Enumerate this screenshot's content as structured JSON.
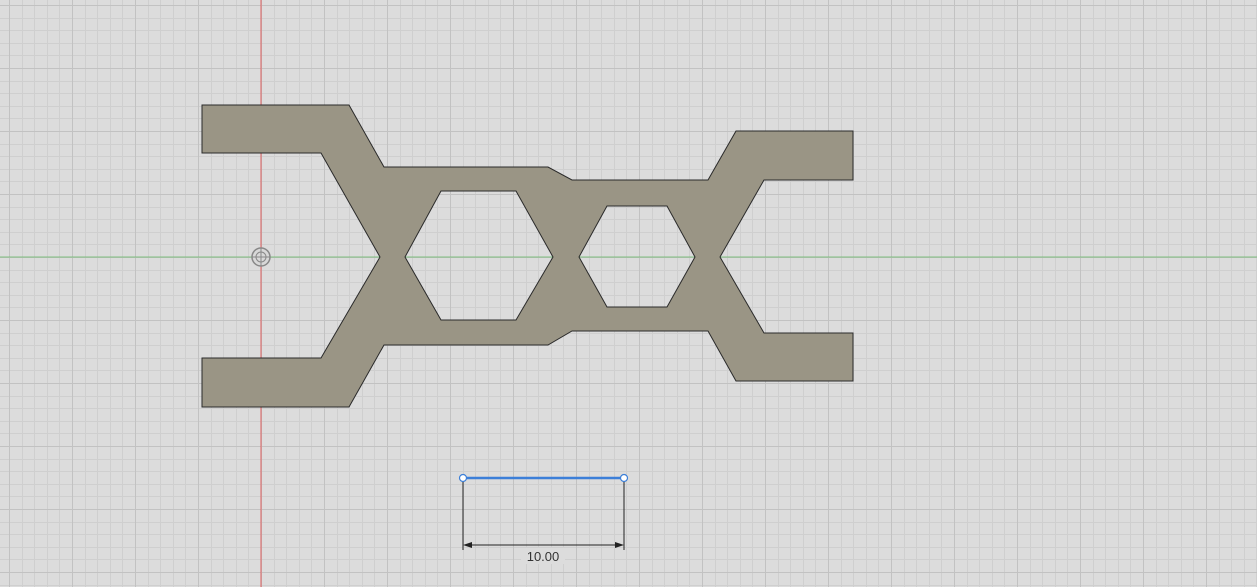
{
  "canvas": {
    "background_color": "#dcdcdc",
    "grid_minor_color": "#cfcfcf",
    "grid_major_color": "#c2c2c2"
  },
  "axes": {
    "x_axis_color": "#7fbf7f",
    "y_axis_color": "#e06060"
  },
  "sketch_profile": {
    "fill_color": "#9a9585",
    "stroke_color": "#2a2a2a"
  },
  "sketch_line": {
    "color": "#3c7fd8",
    "endpoint_color": "#3c7fd8"
  },
  "dimension": {
    "value_text": "10.00",
    "line_color": "#222222"
  },
  "origin_marker": {
    "icon": "origin-point-icon",
    "color": "#888888"
  }
}
